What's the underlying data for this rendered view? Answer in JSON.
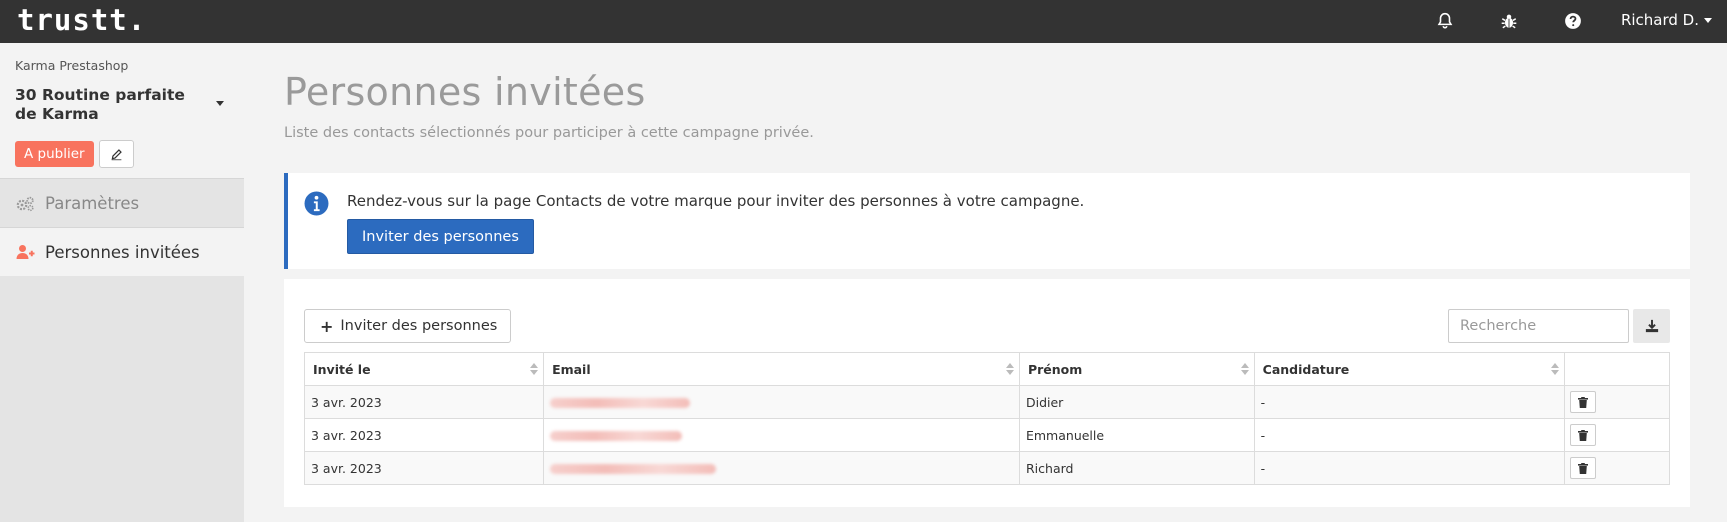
{
  "app": {
    "logo": "trustt."
  },
  "topbar": {
    "icons": {
      "notifications": "bell-icon",
      "bug": "bug-icon",
      "help": "question-circle-icon"
    },
    "user_name": "Richard D."
  },
  "sidebar": {
    "brand": "Karma Prestashop",
    "campaign_title": "30 Routine parfaite de Karma",
    "status_badge": "A publier",
    "items": [
      {
        "label": "Paramètres",
        "icon": "gears-icon",
        "active": false
      },
      {
        "label": "Personnes invitées",
        "icon": "user-plus-icon",
        "active": true
      }
    ]
  },
  "main": {
    "title": "Personnes invitées",
    "subtitle": "Liste des contacts sélectionnés pour participer à cette campagne privée.",
    "info": {
      "text": "Rendez-vous sur la page Contacts de votre marque pour inviter des personnes à votre campagne.",
      "button_label": "Inviter des personnes"
    },
    "toolbar": {
      "invite_label": "Inviter des personnes",
      "search_placeholder": "Recherche",
      "search_value": ""
    },
    "table": {
      "columns": [
        "Invité le",
        "Email",
        "Prénom",
        "Candidature"
      ],
      "rows": [
        {
          "invited": "3 avr. 2023",
          "prenom": "Didier",
          "candidature": "-"
        },
        {
          "invited": "3 avr. 2023",
          "prenom": "Emmanuelle",
          "candidature": "-"
        },
        {
          "invited": "3 avr. 2023",
          "prenom": "Richard",
          "candidature": "-"
        }
      ]
    }
  },
  "colors": {
    "accent": "#2c6bbf",
    "badge": "#f8735e",
    "topbar": "#333333"
  }
}
